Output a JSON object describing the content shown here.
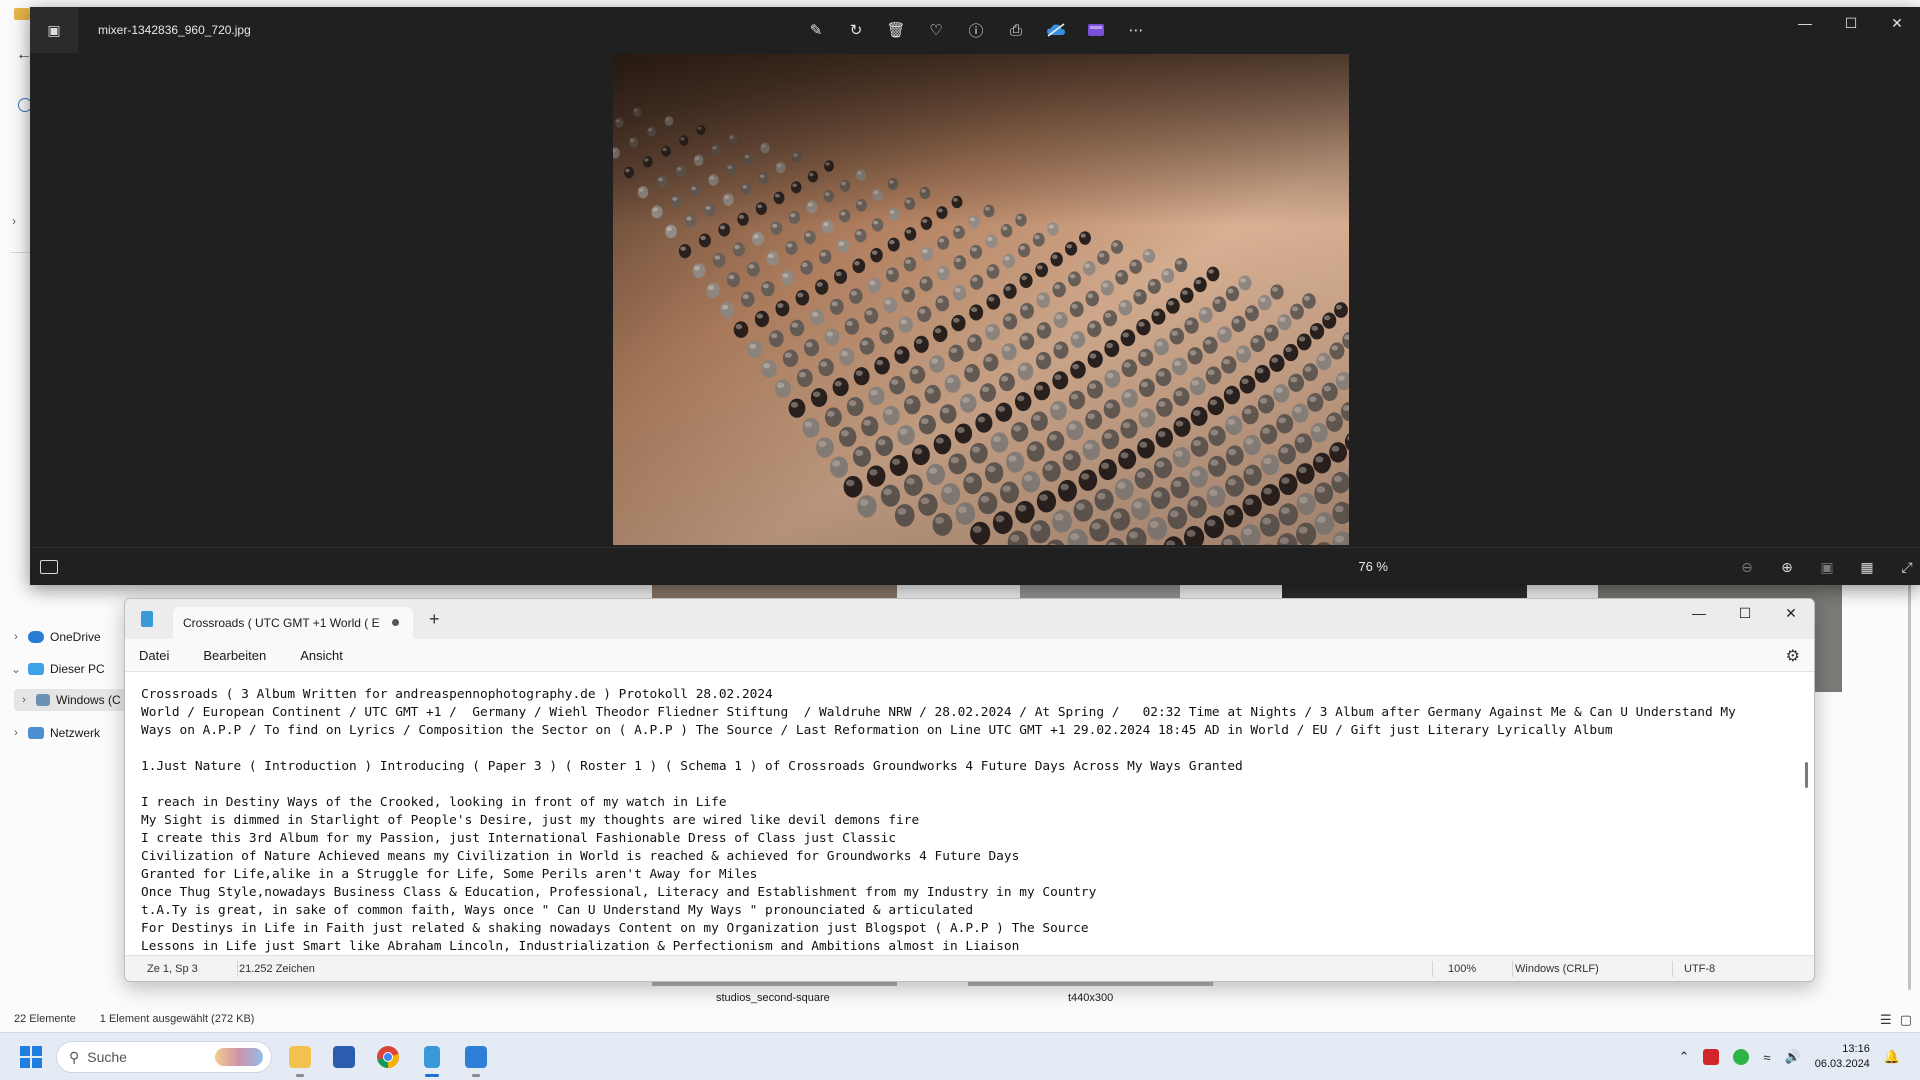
{
  "explorer": {
    "nav": [
      {
        "label": "OneDrive",
        "expanded": false,
        "icon": "cloud-icon"
      },
      {
        "label": "Dieser PC",
        "expanded": true,
        "icon": "pc-icon"
      },
      {
        "label": "Windows (C",
        "expanded": false,
        "icon": "drive-icon",
        "selected": true
      },
      {
        "label": "Netzwerk",
        "expanded": false,
        "icon": "network-icon"
      }
    ],
    "thumbnail_captions": [
      "studios_second-square",
      "t440x300"
    ],
    "status": {
      "count": "22 Elemente",
      "selection": "1 Element ausgewählt (272 KB)"
    }
  },
  "photos": {
    "filename": "mixer-1342836_960_720.jpg",
    "toolbar": [
      "edit-image-icon",
      "rotate-icon",
      "delete-icon",
      "favorite-icon",
      "info-icon",
      "print-icon",
      "onedrive-icon",
      "clipchamp-icon",
      "more-icon"
    ],
    "zoom": "76 %",
    "colors": {
      "background": "#202020",
      "image_warm": "#6b4a36"
    }
  },
  "notepad": {
    "tab_title": "Crossroads ( UTC GMT +1 World ( E",
    "menus": [
      "Datei",
      "Bearbeiten",
      "Ansicht"
    ],
    "lines": [
      "Crossroads ( 3 Album Written for andreaspennophotography.de ) Protokoll 28.02.2024",
      "World / European Continent / UTC GMT +1 /  Germany / Wiehl Theodor Fliedner Stiftung  / Waldruhe NRW / 28.02.2024 / At Spring /   02:32 Time at Nights / 3 Album after Germany Against Me & Can U Understand My",
      "Ways on A.P.P / To find on Lyrics / Composition the Sector on ( A.P.P ) The Source / Last Reformation on Line UTC GMT +1 29.02.2024 18:45 AD in World / EU / Gift just Literary Lyrically Album",
      "",
      "1.Just Nature ( Introduction ) Introducing ( Paper 3 ) ( Roster 1 ) ( Schema 1 ) of Crossroads Groundworks 4 Future Days Across My Ways Granted",
      "",
      "I reach in Destiny Ways of the Crooked, looking in front of my watch in Life",
      "My Sight is dimmed in Starlight of People's Desire, just my thoughts are wired like devil demons fire",
      "I create this 3rd Album for my Passion, just International Fashionable Dress of Class just Classic",
      "Civilization of Nature Achieved means my Civilization in World is reached & achieved for Groundworks 4 Future Days",
      "Granted for Life,alike in a Struggle for Life, Some Perils aren't Away for Miles",
      "Once Thug Style,nowadays Business Class & Education, Professional, Literacy and Establishment from my Industry in my Country",
      "t.A.Ty is great, in sake of common faith, Ways once \" Can U Understand My Ways \" pronounciated & articulated",
      "For Destinys in Life in Faith just related & shaking nowadays Content on my Organization just Blogspot ( A.P.P ) The Source",
      "Lessons in Life just Smart like Abraham Lincoln, Industrialization & Perfectionism and Ambitions almost in Liaison"
    ],
    "status": {
      "position": "Ze 1, Sp 3",
      "chars": "21.252 Zeichen",
      "zoom": "100%",
      "line_ending": "Windows (CRLF)",
      "encoding": "UTF-8"
    }
  },
  "taskbar": {
    "search_placeholder": "Suche",
    "apps": [
      "file-explorer-icon",
      "store-icon",
      "chrome-icon",
      "notepad-icon",
      "photos-icon"
    ],
    "time": "13:16",
    "date": "06.03.2024"
  }
}
